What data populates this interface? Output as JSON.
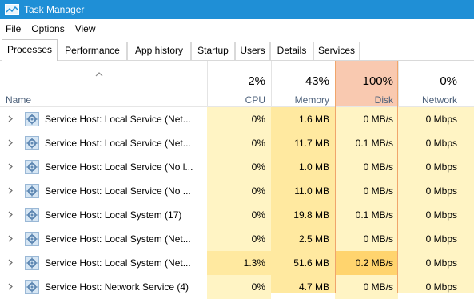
{
  "window": {
    "title": "Task Manager"
  },
  "menu": [
    "File",
    "Options",
    "View"
  ],
  "tabs": [
    "Processes",
    "Performance",
    "App history",
    "Startup",
    "Users",
    "Details",
    "Services"
  ],
  "active_tab": "Processes",
  "columns": {
    "name": {
      "label": "Name"
    },
    "cpu": {
      "percent": "2%",
      "label": "CPU"
    },
    "memory": {
      "percent": "43%",
      "label": "Memory"
    },
    "disk": {
      "percent": "100%",
      "label": "Disk"
    },
    "network": {
      "percent": "0%",
      "label": "Network"
    }
  },
  "colors": {
    "titlebar": "#1f8fd6",
    "cell_light": "#fff4c4",
    "cell_medium": "#ffe9a0",
    "cell_strong": "#ffd46e",
    "disk_header": "#f9c9b0",
    "disk_border": "#f0a56b"
  },
  "processes": [
    {
      "name": "Service Host: Local Service (Net...",
      "cpu": "0%",
      "memory": "1.6 MB",
      "disk": "0 MB/s",
      "network": "0 Mbps",
      "cpu_level": "light",
      "disk_level": "light"
    },
    {
      "name": "Service Host: Local Service (Net...",
      "cpu": "0%",
      "memory": "11.7 MB",
      "disk": "0.1 MB/s",
      "network": "0 Mbps",
      "cpu_level": "light",
      "disk_level": "light"
    },
    {
      "name": "Service Host: Local Service (No l...",
      "cpu": "0%",
      "memory": "1.0 MB",
      "disk": "0 MB/s",
      "network": "0 Mbps",
      "cpu_level": "light",
      "disk_level": "light"
    },
    {
      "name": "Service Host: Local Service (No ...",
      "cpu": "0%",
      "memory": "11.0 MB",
      "disk": "0 MB/s",
      "network": "0 Mbps",
      "cpu_level": "light",
      "disk_level": "light"
    },
    {
      "name": "Service Host: Local System (17)",
      "cpu": "0%",
      "memory": "19.8 MB",
      "disk": "0.1 MB/s",
      "network": "0 Mbps",
      "cpu_level": "light",
      "disk_level": "light"
    },
    {
      "name": "Service Host: Local System (Net...",
      "cpu": "0%",
      "memory": "2.5 MB",
      "disk": "0 MB/s",
      "network": "0 Mbps",
      "cpu_level": "light",
      "disk_level": "light"
    },
    {
      "name": "Service Host: Local System (Net...",
      "cpu": "1.3%",
      "memory": "51.6 MB",
      "disk": "0.2 MB/s",
      "network": "0 Mbps",
      "cpu_level": "medium",
      "disk_level": "strong"
    },
    {
      "name": "Service Host: Network Service (4)",
      "cpu": "0%",
      "memory": "4.7 MB",
      "disk": "0 MB/s",
      "network": "0 Mbps",
      "cpu_level": "light",
      "disk_level": "light"
    }
  ]
}
